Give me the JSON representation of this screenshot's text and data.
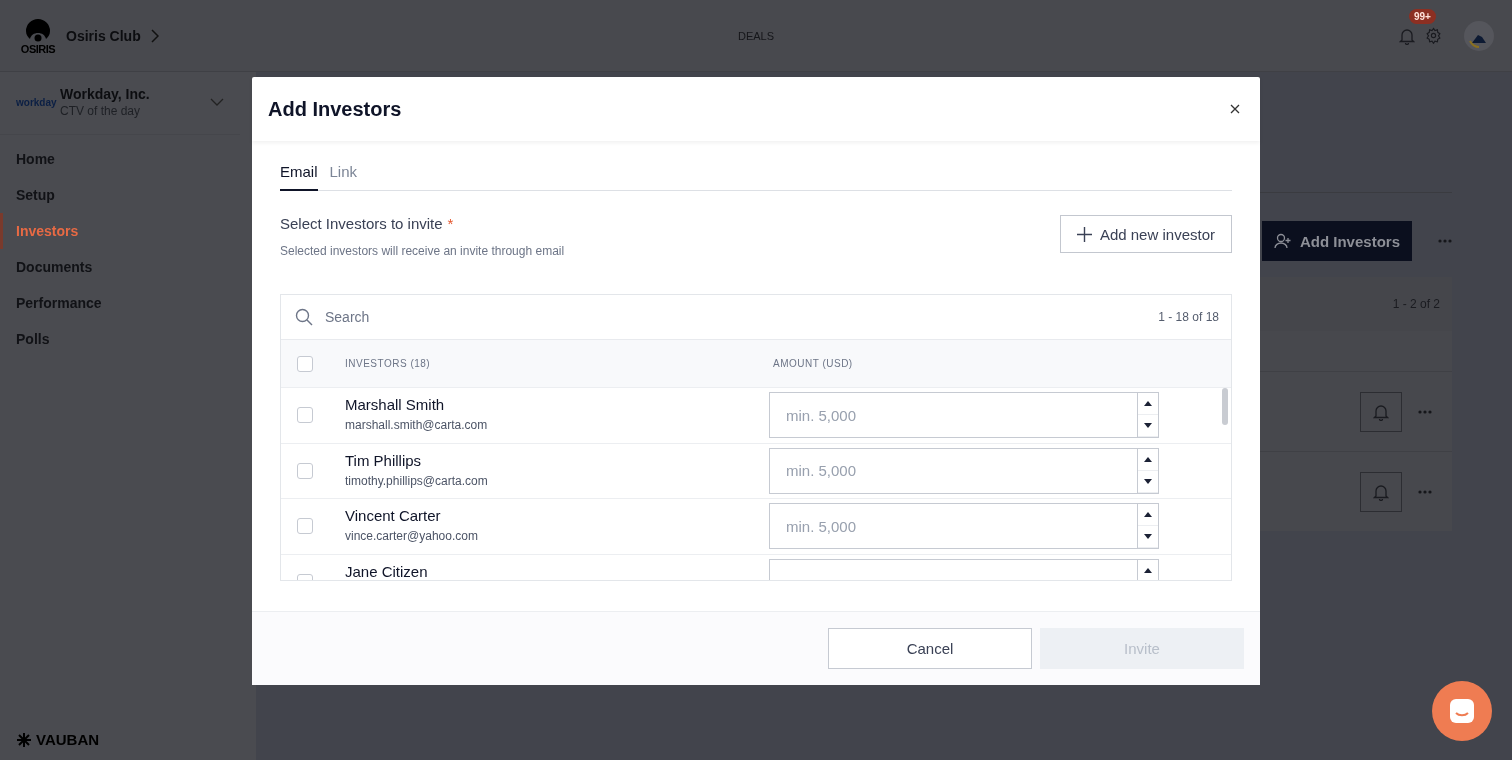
{
  "topbar": {
    "brand": "OSIRIS",
    "org": "Osiris Club",
    "section": "DEALS",
    "notification_badge": "99+"
  },
  "sidebar": {
    "company": {
      "logo": "workday",
      "name": "Workday, Inc.",
      "subtitle": "CTV of the day"
    },
    "items": [
      {
        "label": "Home",
        "selected": false
      },
      {
        "label": "Setup",
        "selected": false
      },
      {
        "label": "Investors",
        "selected": true
      },
      {
        "label": "Documents",
        "selected": false
      },
      {
        "label": "Performance",
        "selected": false
      },
      {
        "label": "Polls",
        "selected": false
      }
    ],
    "footer_brand": "VAUBAN"
  },
  "page": {
    "add_button": "Add Investors",
    "pagination": "1 - 2 of 2"
  },
  "modal": {
    "title": "Add Investors",
    "tabs": [
      {
        "label": "Email",
        "selected": true
      },
      {
        "label": "Link",
        "selected": false
      }
    ],
    "section": {
      "label": "Select Investors to invite",
      "required_mark": "*",
      "helper": "Selected investors will receive an invite through email"
    },
    "add_button": "Add new investor",
    "search": {
      "placeholder": "Search"
    },
    "count": "1 - 18 of 18",
    "select_all": {
      "checked": false
    },
    "columns": [
      "INVESTORS (18)",
      "AMOUNT (USD)"
    ],
    "rows": [
      {
        "name": "Marshall Smith",
        "email": "marshall.smith@carta.com",
        "checked": false,
        "placeholder": "min. 5,000"
      },
      {
        "name": "Tim Phillips",
        "email": "timothy.phillips@carta.com",
        "checked": false,
        "placeholder": "min. 5,000"
      },
      {
        "name": "Vincent Carter",
        "email": "vince.carter@yahoo.com",
        "checked": false,
        "placeholder": "min. 5,000"
      },
      {
        "name": "Jane Citizen",
        "checked": false
      }
    ],
    "cancel": "Cancel",
    "invite": {
      "label": "Invite",
      "disabled": true
    }
  }
}
